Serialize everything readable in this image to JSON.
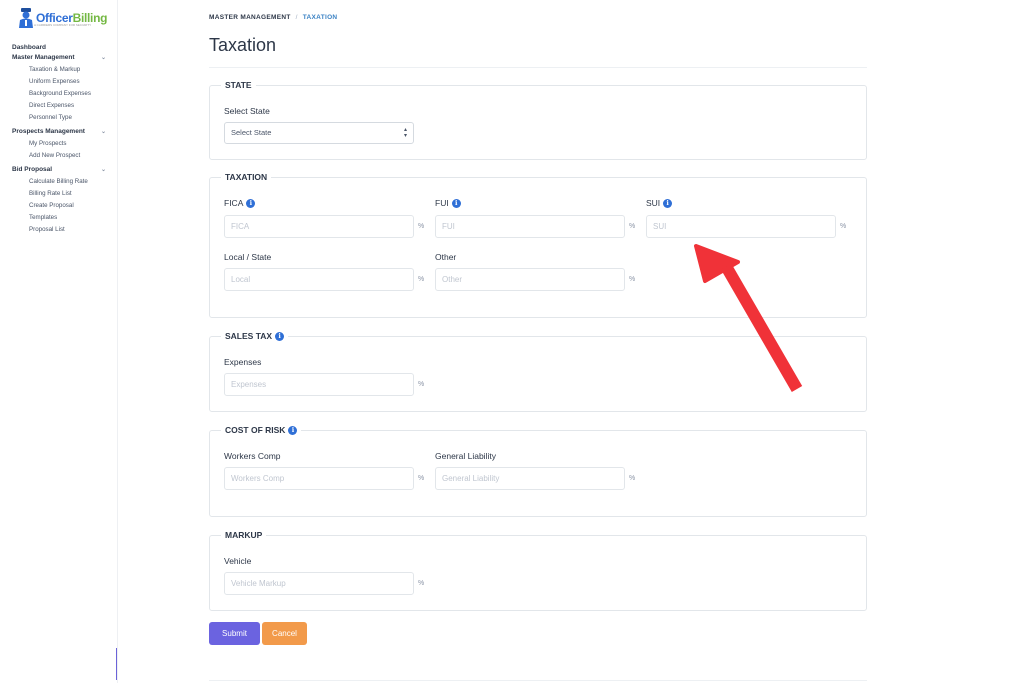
{
  "brand": {
    "name_part1": "Officer",
    "name_part2": "Billing",
    "tagline": "A CARRIERS COMPANY FOR SECURITY"
  },
  "sidebar": {
    "dashboard": "Dashboard",
    "sections": [
      {
        "label": "Master Management",
        "items": [
          "Taxation & Markup",
          "Uniform Expenses",
          "Background Expenses",
          "Direct Expenses",
          "Personnel Type"
        ]
      },
      {
        "label": "Prospects Management",
        "items": [
          "My Prospects",
          "Add New Prospect"
        ]
      },
      {
        "label": "Bid Proposal",
        "items": [
          "Calculate Billing Rate",
          "Billing Rate List",
          "Create Proposal",
          "Templates",
          "Proposal List"
        ]
      }
    ]
  },
  "breadcrumb": {
    "parent": "MASTER MANAGEMENT",
    "separator": "/",
    "current": "TAXATION"
  },
  "page": {
    "title": "Taxation"
  },
  "state_section": {
    "legend": "STATE",
    "label": "Select State",
    "selected": "Select State"
  },
  "taxation_section": {
    "legend": "TAXATION",
    "fica": {
      "label": "FICA",
      "placeholder": "FICA",
      "unit": "%"
    },
    "fui": {
      "label": "FUI",
      "placeholder": "FUI",
      "unit": "%"
    },
    "sui": {
      "label": "SUI",
      "placeholder": "SUI",
      "unit": "%"
    },
    "local": {
      "label": "Local / State",
      "placeholder": "Local",
      "unit": "%"
    },
    "other": {
      "label": "Other",
      "placeholder": "Other",
      "unit": "%"
    }
  },
  "sales_tax_section": {
    "legend": "SALES TAX",
    "expenses": {
      "label": "Expenses",
      "placeholder": "Expenses",
      "unit": "%"
    }
  },
  "cost_of_risk_section": {
    "legend": "COST OF RISK",
    "workers_comp": {
      "label": "Workers Comp",
      "placeholder": "Workers Comp",
      "unit": "%"
    },
    "general_liability": {
      "label": "General Liability",
      "placeholder": "General Liability",
      "unit": "%"
    }
  },
  "markup_section": {
    "legend": "MARKUP",
    "vehicle": {
      "label": "Vehicle",
      "placeholder": "Vehicle Markup",
      "unit": "%"
    }
  },
  "buttons": {
    "submit": "Submit",
    "cancel": "Cancel"
  },
  "icons": {
    "info": "info-icon",
    "chevron": "chevron-down-icon",
    "annotation": "red-arrow-annotation"
  },
  "colors": {
    "primary": "#6b63e0",
    "cancel": "#f29a4a",
    "info": "#2f6fd6",
    "annotation": "#f03238"
  }
}
